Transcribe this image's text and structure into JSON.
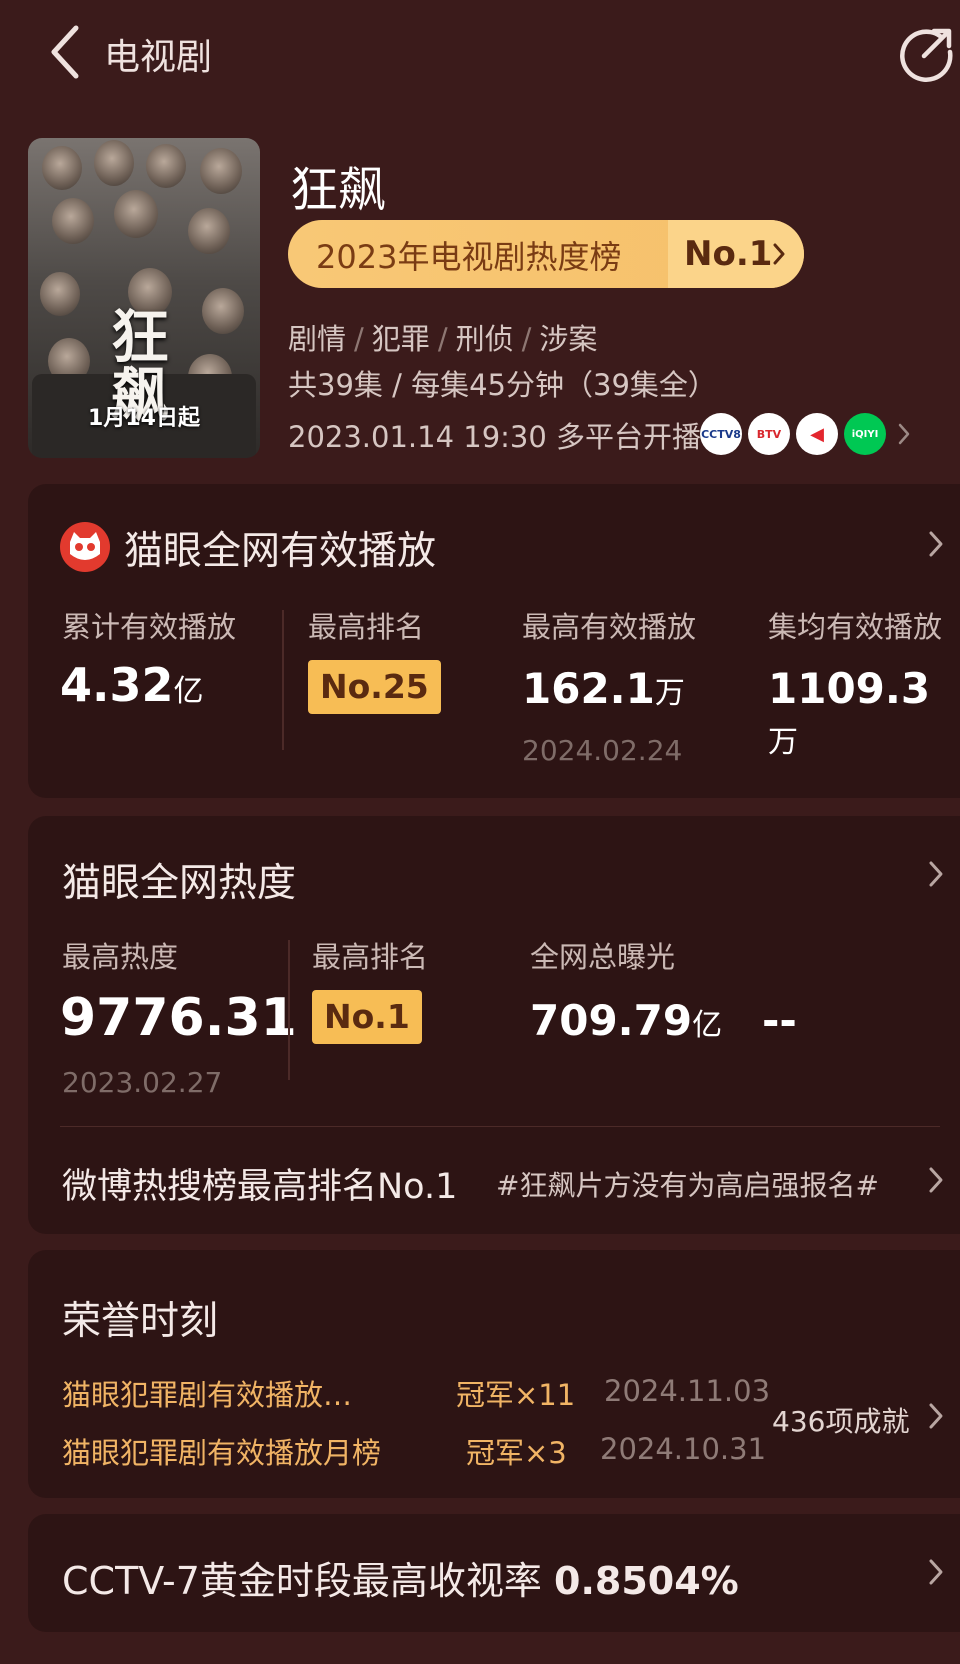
{
  "header": {
    "title": "电视剧",
    "back_icon": "chevron-left-icon",
    "share_icon": "share-icon"
  },
  "show": {
    "poster_title": "狂飙",
    "poster_date": "1月14日起",
    "title": "狂飙",
    "rank_label": "2023年电视剧热度榜",
    "rank_value": "No.1",
    "genres": [
      "剧情",
      "犯罪",
      "刑侦",
      "涉案"
    ],
    "episodes": "共39集 / 每集45分钟（39集全）",
    "airing": "2023.01.14 19:30 多平台开播",
    "platforms": [
      {
        "name": "CCTV-8",
        "label": "CCTV8",
        "bg": "#ffffff",
        "fg": "#1b3a8a"
      },
      {
        "name": "BTV",
        "label": "BTV",
        "bg": "#ffffff",
        "fg": "#d8282e"
      },
      {
        "name": "youku",
        "label": "◀",
        "bg": "#ffffff",
        "fg": "#e3262e"
      },
      {
        "name": "iqiyi",
        "label": "iQIYI",
        "bg": "#00c853",
        "fg": "#ffffff"
      }
    ]
  },
  "maoyan_play": {
    "title": "猫眼全网有效播放",
    "cumulative": {
      "label": "累计有效播放",
      "value": "4.32",
      "unit": "亿"
    },
    "rank": {
      "label": "最高排名",
      "value": "No.25"
    },
    "peak_play": {
      "label": "最高有效播放",
      "value": "162.1",
      "unit": "万",
      "date": "2024.02.24"
    },
    "avg_play": {
      "label": "集均有效播放",
      "value": "1109.3",
      "unit": "万"
    }
  },
  "maoyan_heat": {
    "title": "猫眼全网热度",
    "peak_heat": {
      "label": "最高热度",
      "value": "9776.31",
      "date": "2023.02.27"
    },
    "rank": {
      "label": "最高排名",
      "value": "No.1"
    },
    "exposure": {
      "label": "全网总曝光",
      "value": "709.79",
      "unit": "亿"
    },
    "extra": {
      "value": "--"
    },
    "weibo": {
      "label": "微博热搜榜最高排名No.1",
      "tag": "#狂飙片方没有为高启强报名#"
    }
  },
  "honors": {
    "title": "荣誉时刻",
    "items": [
      {
        "name": "猫眼犯罪剧有效播放…",
        "champ": "冠军×11",
        "date": "2024.11.03"
      },
      {
        "name": "猫眼犯罪剧有效播放月榜",
        "champ": "冠军×3",
        "date": "2024.10.31"
      }
    ],
    "count": "436项成就"
  },
  "ratings": {
    "label": "CCTV-7黄金时段最高收视率",
    "value": "0.8504%"
  },
  "colors": {
    "background": "#3b1b1b",
    "card": "#2d1414",
    "accent": "#f4b24a",
    "badge": "#f7bd55"
  }
}
